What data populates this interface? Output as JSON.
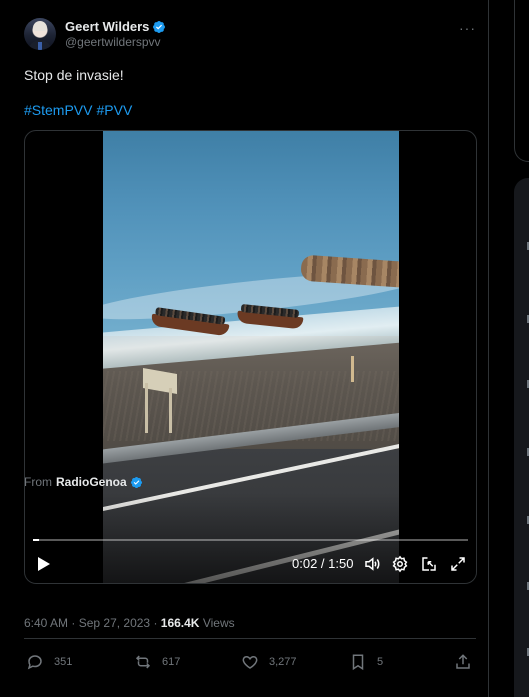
{
  "tweet": {
    "author_name": "Geert Wilders",
    "author_handle": "@geertwilderspvv",
    "more_glyph": "···",
    "text": "Stop de invasie!",
    "hashtags": [
      "#StemPVV",
      "#PVV"
    ]
  },
  "video": {
    "time": "0:02 / 1:50",
    "progress_fraction": 0.013
  },
  "source": {
    "prefix": "From",
    "name": "RadioGenoa"
  },
  "meta": {
    "time": "6:40 AM",
    "separator": " · ",
    "date": "Sep 27, 2023",
    "dot": " · ",
    "views_count": "166.4K",
    "views_label": " Views"
  },
  "actions": {
    "replies": "351",
    "reposts": "617",
    "likes": "3,277",
    "bookmarks": "5"
  },
  "colors": {
    "accent": "#1d9bf0",
    "text_primary": "#e7e9ea",
    "text_secondary": "#71767b",
    "border": "#2f3336",
    "background": "#000000"
  },
  "icons": [
    "verified-badge-icon",
    "more-icon",
    "play-icon",
    "volume-icon",
    "settings-icon",
    "pip-icon",
    "fullscreen-icon",
    "reply-icon",
    "repost-icon",
    "like-icon",
    "bookmark-icon",
    "share-icon"
  ]
}
